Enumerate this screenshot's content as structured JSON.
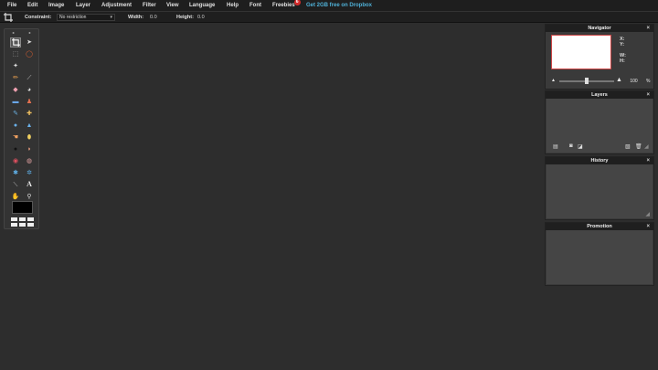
{
  "menubar": {
    "items": [
      "File",
      "Edit",
      "Image",
      "Layer",
      "Adjustment",
      "Filter",
      "View",
      "Language",
      "Help",
      "Font",
      "Freebies"
    ],
    "freebies_badge": "6",
    "promo_link": "Get 2GB free on Dropbox"
  },
  "options": {
    "constraint_label": "Constraint:",
    "constraint_value": "No restriction",
    "width_label": "Width:",
    "width_value": "0.0",
    "height_label": "Height:",
    "height_value": "0.0"
  },
  "navigator": {
    "title": "Navigator",
    "x_label": "X:",
    "y_label": "Y:",
    "w_label": "W:",
    "h_label": "H:",
    "zoom_value": "100",
    "zoom_unit": "%"
  },
  "layers": {
    "title": "Layers"
  },
  "history": {
    "title": "History"
  },
  "promotion": {
    "title": "Promotion"
  },
  "panel_close_glyph": "×",
  "colors": {
    "primary_swatch": "#000000",
    "background": "#2d2d2d",
    "promo_link": "#4fb1d8"
  }
}
